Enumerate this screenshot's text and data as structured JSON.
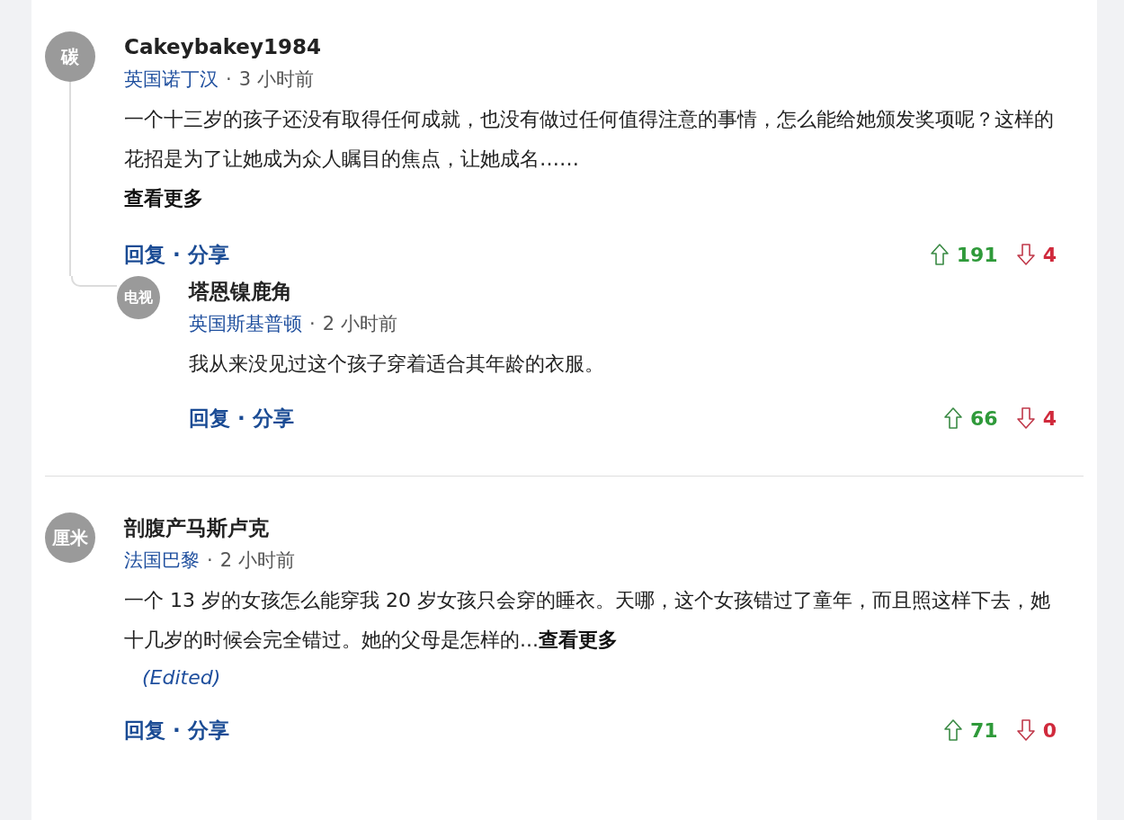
{
  "comments": [
    {
      "avatar": "碳",
      "author": "Cakeybakey1984",
      "location": "英国诺丁汉",
      "time": "3 小时前",
      "separator": "·",
      "body": "一个十三岁的孩子还没有取得任何成就，也没有做过任何值得注意的事情，怎么能给她颁发奖项呢？这样的花招是为了让她成为众人瞩目的焦点，让她成名……",
      "more": "查看更多",
      "actions": [
        "回复",
        "分享"
      ],
      "upvotes": "191",
      "downvotes": "4",
      "replies": [
        {
          "avatar": "电视",
          "author": "塔恩镍鹿角",
          "location": "英国斯基普顿",
          "time": "2 小时前",
          "separator": "·",
          "body": "我从来没见过这个孩子穿着适合其年龄的衣服。",
          "actions": [
            "回复",
            "分享"
          ],
          "upvotes": "66",
          "downvotes": "4"
        }
      ]
    },
    {
      "avatar": "厘米",
      "author": "剖腹产马斯卢克",
      "location": "法国巴黎",
      "time": "2 小时前",
      "separator": "·",
      "body": "一个 13 岁的女孩怎么能穿我 20 岁女孩只会穿的睡衣。天哪，这个女孩错过了童年，而且照这样下去，她十几岁的时候会完全错过。她的父母是怎样的...",
      "inline_more": "查看更多",
      "edited": "(Edited)",
      "actions": [
        "回复",
        "分享"
      ],
      "upvotes": "71",
      "downvotes": "0"
    }
  ]
}
